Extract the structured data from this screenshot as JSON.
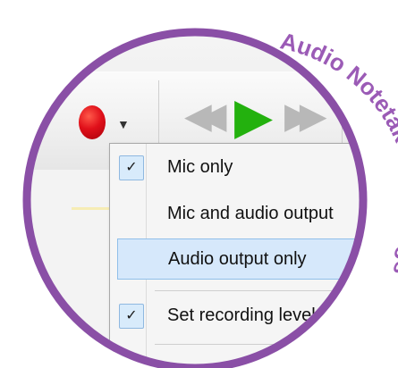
{
  "toolbar": {
    "record_icon": "record-dot-icon",
    "dropdown_icon": "dropdown-arrow-icon",
    "rewind_icon": "rewind-icon",
    "play_icon": "play-icon",
    "forward_icon": "fast-forward-icon"
  },
  "menu": {
    "items": [
      {
        "label": "Mic only",
        "checked": true
      },
      {
        "label": "Mic and audio output",
        "checked": false
      },
      {
        "label": "Audio output only",
        "checked": false,
        "highlighted": true
      },
      {
        "label": "Set recording level",
        "checked": true
      }
    ]
  },
  "caption": {
    "text": "Audio Notetaker - settings"
  },
  "colors": {
    "ring": "#8a4fa6",
    "caption": "#9b5bb6",
    "play": "#23b10e",
    "record": "#e0101a",
    "highlight": "#d6e8fb"
  }
}
